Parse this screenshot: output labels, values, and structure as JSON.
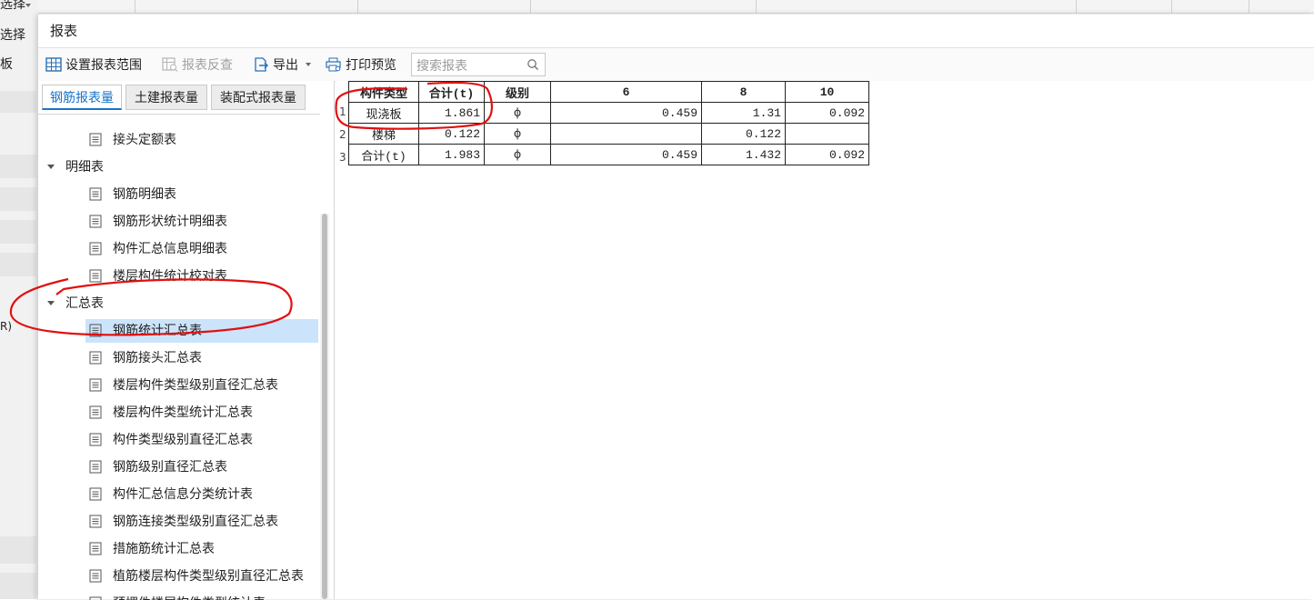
{
  "background": {
    "left_texts": [
      "选择",
      "选择",
      "板",
      "R)"
    ]
  },
  "window": {
    "title": "报表"
  },
  "toolbar": {
    "set_range_label": "设置报表范围",
    "reverse_check_label": "报表反查",
    "export_label": "导出",
    "print_preview_label": "打印预览",
    "search_placeholder": "搜索报表"
  },
  "tabs": [
    {
      "label": "钢筋报表量",
      "active": true
    },
    {
      "label": "土建报表量",
      "active": false
    },
    {
      "label": "装配式报表量",
      "active": false
    }
  ],
  "tree": {
    "items": [
      {
        "label": "接头定额表"
      }
    ],
    "groups": [
      {
        "label": "明细表",
        "items": [
          {
            "label": "钢筋明细表"
          },
          {
            "label": "钢筋形状统计明细表"
          },
          {
            "label": "构件汇总信息明细表"
          },
          {
            "label": "楼层构件统计校对表"
          }
        ]
      },
      {
        "label": "汇总表",
        "items": [
          {
            "label": "钢筋统计汇总表",
            "selected": true
          },
          {
            "label": "钢筋接头汇总表"
          },
          {
            "label": "楼层构件类型级别直径汇总表"
          },
          {
            "label": "楼层构件类型统计汇总表"
          },
          {
            "label": "构件类型级别直径汇总表"
          },
          {
            "label": "钢筋级别直径汇总表"
          },
          {
            "label": "构件汇总信息分类统计表"
          },
          {
            "label": "钢筋连接类型级别直径汇总表"
          },
          {
            "label": "措施筋统计汇总表"
          },
          {
            "label": "植筋楼层构件类型级别直径汇总表"
          },
          {
            "label": "预埋件楼层构件类型统计表"
          }
        ]
      }
    ]
  },
  "report_table": {
    "headers": [
      "构件类型",
      "合计(t)",
      "级别",
      "6",
      "8",
      "10"
    ],
    "row_numbers": [
      "1",
      "2",
      "3"
    ],
    "rows": [
      [
        "现浇板",
        "1.861",
        "ф",
        "0.459",
        "1.31",
        "0.092"
      ],
      [
        "楼梯",
        "0.122",
        "ф",
        "",
        "0.122",
        ""
      ],
      [
        "合计(t)",
        "1.983",
        "ф",
        "0.459",
        "1.432",
        "0.092"
      ]
    ]
  },
  "colors": {
    "accent": "#1a73c9",
    "selection": "#cce4fb",
    "annotation": "#e01010"
  }
}
